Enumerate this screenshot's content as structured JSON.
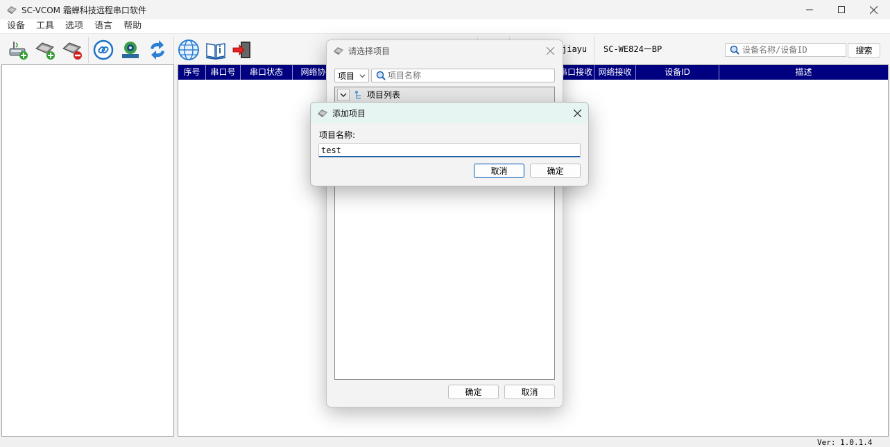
{
  "app": {
    "title": "SC-VCOM 霜蝉科技远程串口软件",
    "version": "Ver: 1.0.1.4"
  },
  "menu": [
    "设备",
    "工具",
    "选项",
    "语言",
    "帮助"
  ],
  "toolbar": {
    "icons": [
      "add-device-icon",
      "add-gateway-icon",
      "remove-device-icon",
      "link-icon",
      "camera-icon",
      "refresh-icon",
      "globe-icon",
      "manual-book-icon",
      "exit-icon"
    ],
    "user_label": "jiayu",
    "model_label": "SC-WE824ーBP",
    "search_placeholder": "设备名称/设备ID",
    "search_button": "搜索"
  },
  "grid": {
    "columns": [
      "序号",
      "串口号",
      "串口状态",
      "网络协",
      "串口接收",
      "网络接收",
      "设备ID",
      "描述"
    ]
  },
  "select_dialog": {
    "title": "请选择项目",
    "combo_value": "项目",
    "search_placeholder": "项目名称",
    "tree_root": "项目列表",
    "ok_label": "确定",
    "cancel_label": "取消"
  },
  "add_dialog": {
    "title": "添加项目",
    "field_label": "项目名称:",
    "field_value": "test",
    "cancel_label": "取消",
    "ok_label": "确定"
  },
  "colors": {
    "grid_header": "#000080",
    "accent": "#1f5fa6",
    "dialog_title_bg": "#e6f5f2"
  }
}
